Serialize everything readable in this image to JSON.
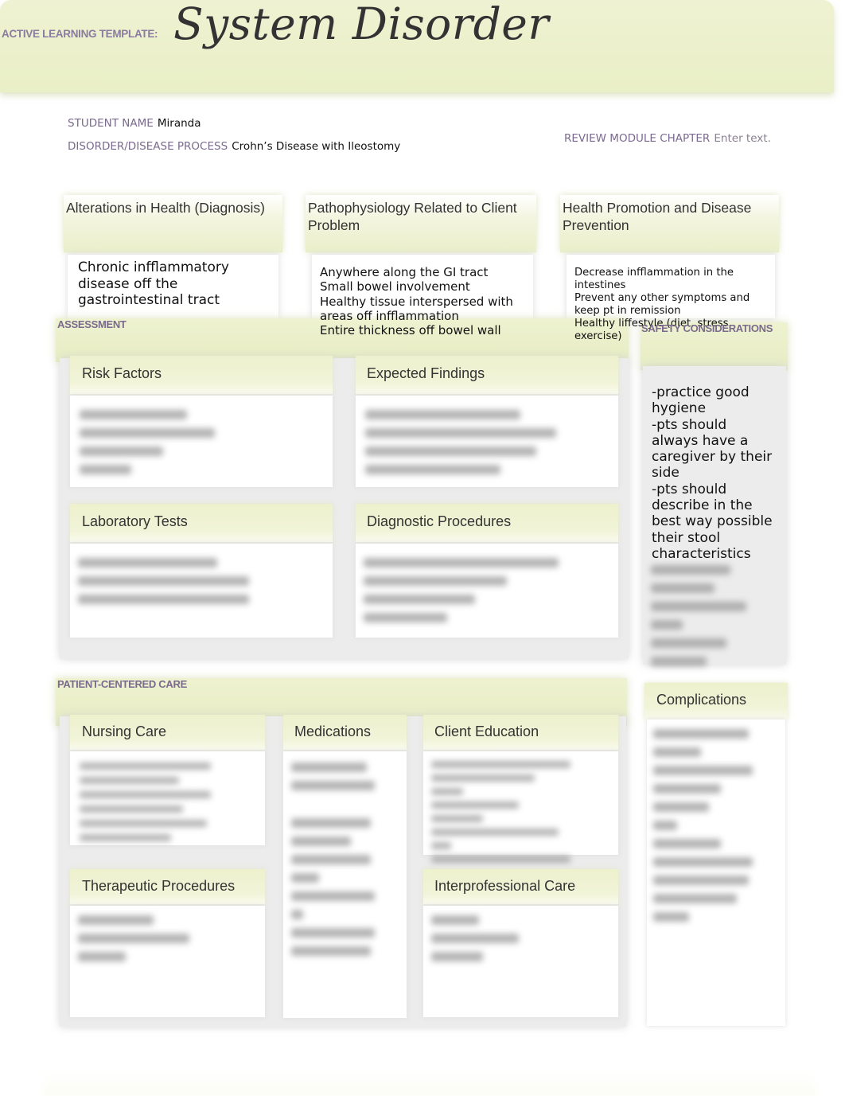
{
  "header": {
    "template_label": "ACTIVE LEARNING TEMPLATE:",
    "title": "System Disorder"
  },
  "meta": {
    "student_name_label": "STUDENT NAME",
    "student_name_value": "Miranda",
    "disorder_label": "DISORDER/DISEASE PROCESS",
    "disorder_value": "Crohn’s Disease with Ileostomy",
    "review_label": "REVIEW MODULE CHAPTER",
    "review_value": "Enter text."
  },
  "top_boxes": [
    {
      "title": "Alterations in Health (Diagnosis)",
      "lines": [
        "Chronic infflammatory",
        "disease off the",
        "gastrointestinal tract"
      ]
    },
    {
      "title": "Pathophysiology Related to Client Problem",
      "lines": [
        "Anywhere along the GI tract",
        "Small bowel involvement",
        "Healthy tissue interspersed with",
        "areas off infflammation",
        "Entire thickness off bowel wall"
      ]
    },
    {
      "title": "Health Promotion and Disease Prevention",
      "lines": [
        "Decrease infflammation in the",
        "intestines",
        "Prevent any other symptoms and",
        "keep pt in remission",
        "Healthy liffestyle (diet, stress,",
        "exercise)"
      ]
    }
  ],
  "assessment": {
    "label": "ASSESSMENT",
    "cards": [
      {
        "title": "Risk Factors"
      },
      {
        "title": "Expected Findings"
      },
      {
        "title": "Laboratory Tests"
      },
      {
        "title": "Diagnostic Procedures"
      }
    ]
  },
  "safety": {
    "label": "SAFETY CONSIDERATIONS",
    "lines": [
      "-practice good",
      "hygiene",
      "-pts should",
      "always have a",
      "caregiver by their",
      "side",
      "-pts should",
      "describe in the",
      "best way possible",
      "their stool",
      "characteristics"
    ]
  },
  "patient_care": {
    "label": "PATIENT-CENTERED CARE",
    "cards": [
      {
        "title": "Nursing Care"
      },
      {
        "title": "Medications"
      },
      {
        "title": "Client Education"
      },
      {
        "title": "Therapeutic Procedures"
      },
      {
        "title": "Interprofessional Care"
      }
    ]
  },
  "complications": {
    "title": "Complications"
  },
  "colors": {
    "banner": "#eaefc8",
    "label_purple": "#7a6a8e",
    "card_header": "#eef2cf",
    "panel_grey": "#ececec"
  }
}
